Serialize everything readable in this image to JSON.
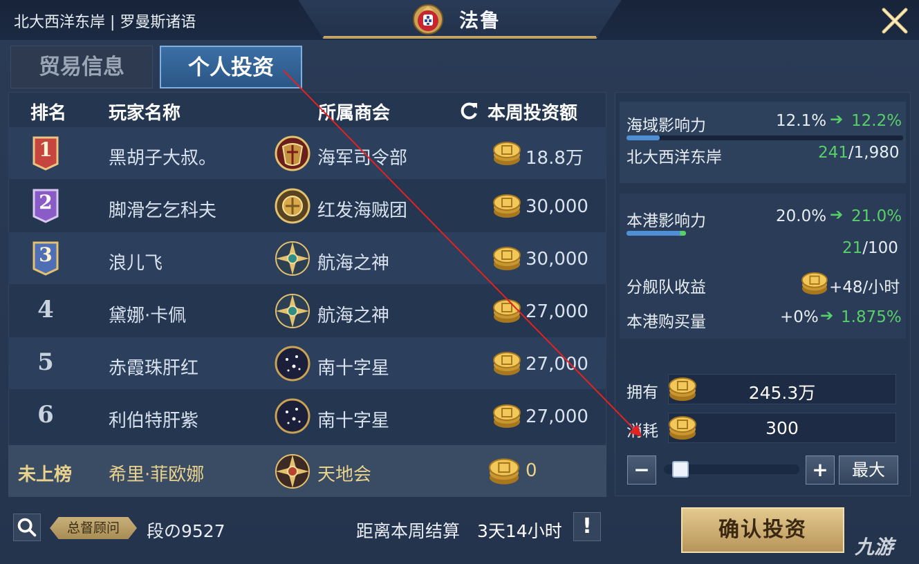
{
  "header": {
    "region": "北大西洋东岸 | 罗曼斯诸语",
    "port_name": "法鲁",
    "emblem_icon": "portugal-coat-of-arms",
    "close_icon": "close-x-gold"
  },
  "tabs": [
    {
      "label": "贸易信息",
      "active": false
    },
    {
      "label": "个人投资",
      "active": true
    }
  ],
  "table": {
    "headers": {
      "rank": "排名",
      "player": "玩家名称",
      "guild": "所属商会",
      "amount": "本周投资额"
    },
    "rows": [
      {
        "rank": "1",
        "player": "黑胡子大叔。",
        "guild": "海军司令部",
        "amount": "18.8万",
        "badge_color": "#c6453f",
        "guild_icon": "navy-crest"
      },
      {
        "rank": "2",
        "player": "脚滑乞乞科夫",
        "guild": "红发海贼团",
        "amount": "30,000",
        "badge_color": "#8a5cc8",
        "guild_icon": "redhair-crest"
      },
      {
        "rank": "3",
        "player": "浪儿飞",
        "guild": "航海之神",
        "amount": "30,000",
        "badge_color": "#4e6fb6",
        "guild_icon": "compass-star-crest"
      },
      {
        "rank": "4",
        "player": "黛娜·卡佩",
        "guild": "航海之神",
        "amount": "27,000",
        "guild_icon": "compass-star-crest"
      },
      {
        "rank": "5",
        "player": "赤霞珠肝红",
        "guild": "南十字星",
        "amount": "27,000",
        "guild_icon": "southern-cross-crest"
      },
      {
        "rank": "6",
        "player": "利伯特肝紫",
        "guild": "南十字星",
        "amount": "27,000",
        "guild_icon": "southern-cross-crest"
      }
    ],
    "my_row": {
      "rank": "未上榜",
      "player": "希里·菲欧娜",
      "guild": "天地会",
      "amount": "0",
      "guild_icon": "compass-star-crest"
    }
  },
  "influence": {
    "sea_label": "海域影响力",
    "sea_current": "12.1%",
    "sea_next": "12.2%",
    "sea_bar": 0.121,
    "region_label": "北大西洋东岸",
    "region_rank": "241",
    "region_total": "/1,980",
    "port_label": "本港影响力",
    "port_current": "20.0%",
    "port_next": "21.0%",
    "port_bar": 0.21,
    "port_rank": "21",
    "port_total": "/100",
    "fleet_label": "分舰队收益",
    "fleet_value": "+48/小时",
    "purchase_label": "本港购买量",
    "purchase_current": "+0%",
    "purchase_next": "1.875%"
  },
  "investment": {
    "own_label": "拥有",
    "own_value": "245.3万",
    "cost_label": "消耗",
    "cost_value": "300",
    "slider_value": 0.05,
    "minus_label": "−",
    "plus_label": "+",
    "max_label": "最大"
  },
  "footer": {
    "role_badge": "总督顾问",
    "player_name": "段の9527",
    "settle_label": "距离本周结算",
    "settle_time": "3天14小时",
    "info_label": "!",
    "confirm_label": "确认投资",
    "watermark": "九游"
  },
  "colors": {
    "accent_blue": "#3c6fa6",
    "gold": "#c7a868",
    "green": "#58d06a",
    "my_row_text": "#e8d28c"
  }
}
